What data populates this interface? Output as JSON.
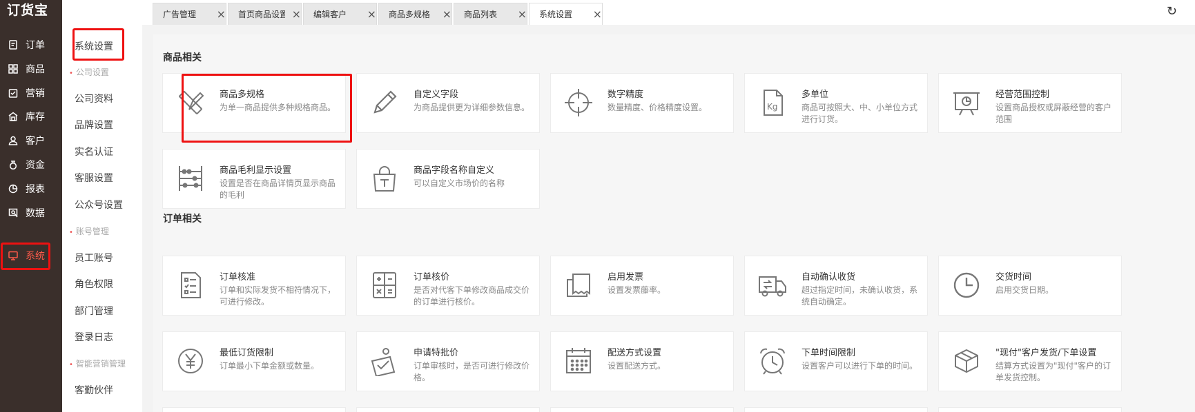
{
  "app": {
    "logo": "订货宝"
  },
  "nav": {
    "items": [
      {
        "label": "订单",
        "icon": "order-icon"
      },
      {
        "label": "商品",
        "icon": "grid-icon"
      },
      {
        "label": "营销",
        "icon": "marketing-icon"
      },
      {
        "label": "库存",
        "icon": "warehouse-icon"
      },
      {
        "label": "客户",
        "icon": "user-icon"
      },
      {
        "label": "资金",
        "icon": "money-bag-icon"
      },
      {
        "label": "报表",
        "icon": "pie-chart-icon"
      },
      {
        "label": "数据",
        "icon": "data-icon"
      },
      {
        "label": "系统",
        "icon": "monitor-icon",
        "active": true
      }
    ]
  },
  "subnav": {
    "title": "系统设置",
    "group1": "公司设置",
    "group1_items": [
      "公司资料",
      "品牌设置",
      "实名认证",
      "客服设置",
      "公众号设置"
    ],
    "group2": "账号管理",
    "group2_items": [
      "员工账号",
      "角色权限",
      "部门管理",
      "登录日志"
    ],
    "group3": "智能营销管理",
    "group3_items": [
      "客勤伙伴"
    ]
  },
  "tabs": [
    {
      "label": "广告管理"
    },
    {
      "label": "首页商品设置"
    },
    {
      "label": "编辑客户"
    },
    {
      "label": "商品多规格"
    },
    {
      "label": "商品列表"
    },
    {
      "label": "系统设置",
      "active": true
    }
  ],
  "sections": {
    "goods_title": "商品相关",
    "order_title": "订单相关"
  },
  "goods_cards": [
    {
      "title": "商品多规格",
      "desc": "为单一商品提供多种规格商品。",
      "icon": "ruler-pencil-icon"
    },
    {
      "title": "自定义字段",
      "desc": "为商品提供更为详细参数信息。",
      "icon": "pencil-icon"
    },
    {
      "title": "数字精度",
      "desc": "数量精度、价格精度设置。",
      "icon": "crosshair-icon"
    },
    {
      "title": "多单位",
      "desc": "商品可按照大、中、小单位方式进行订货。",
      "icon": "weight-unit-icon"
    },
    {
      "title": "经营范围控制",
      "desc": "设置商品授权或屏蔽经营的客户范围",
      "icon": "presentation-board-icon"
    },
    {
      "title": "商品毛利显示设置",
      "desc": "设置是否在商品详情页显示商品的毛利",
      "icon": "abacus-icon"
    },
    {
      "title": "商品字段名称自定义",
      "desc": "可以自定义市场价的名称",
      "icon": "shopping-bag-icon"
    }
  ],
  "order_cards": [
    {
      "title": "订单核准",
      "desc": "订单和实际发货不相符情况下，可进行修改。",
      "icon": "checklist-icon"
    },
    {
      "title": "订单核价",
      "desc": "是否对代客下单修改商品成交价的订单进行核价。",
      "icon": "calculator-icon"
    },
    {
      "title": "启用发票",
      "desc": "设置发票藤率。",
      "icon": "invoice-icon"
    },
    {
      "title": "自动确认收货",
      "desc": "超过指定时间，未确认收货，系统自动确定。",
      "icon": "truck-icon"
    },
    {
      "title": "交货时间",
      "desc": "启用交货日期。",
      "icon": "clock-icon"
    },
    {
      "title": "最低订货限制",
      "desc": "订单最小下单金额或数量。",
      "icon": "yen-icon"
    },
    {
      "title": "申请特批价",
      "desc": "订单审核时，是否可进行修改价格。",
      "icon": "approval-icon"
    },
    {
      "title": "配送方式设置",
      "desc": "设置配送方式。",
      "icon": "calendar-icon"
    },
    {
      "title": "下单时间限制",
      "desc": "设置客户可以进行下单的时间。",
      "icon": "alarm-clock-icon"
    },
    {
      "title": "\"现付\"客户发货/下单设置",
      "desc": "结算方式设置为\"现付\"客户的订单发货控制。",
      "icon": "package-icon"
    }
  ]
}
